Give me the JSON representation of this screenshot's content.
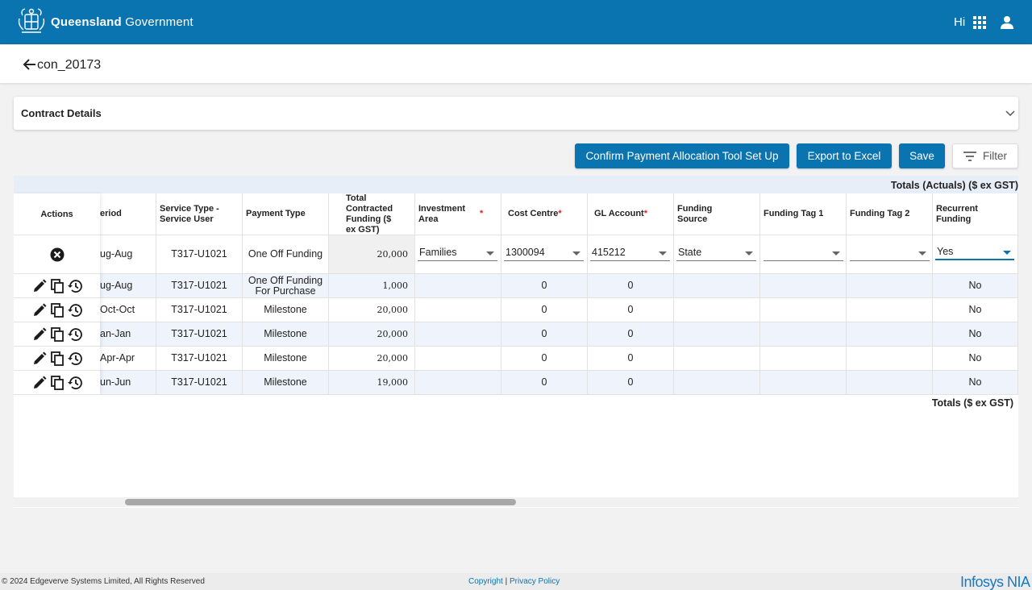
{
  "header": {
    "brand_bold": "Queensland",
    "brand_rest": "Government",
    "greeting": "Hi"
  },
  "page": {
    "title": "con_20173"
  },
  "panel": {
    "title": "Contract Details"
  },
  "toolbar": {
    "confirm_label": "Confirm Payment Allocation Tool Set Up",
    "export_label": "Export to Excel",
    "save_label": "Save",
    "filter_label": "Filter"
  },
  "grid": {
    "totals_actuals": "Totals (Actuals) ($ ex GST)",
    "totals": "Totals ($ ex GST)",
    "columns": {
      "actions": "Actions",
      "period": "eriod",
      "service_type": "Service Type - Service User",
      "payment_type": "Payment Type",
      "total_funding": "Total Contracted Funding ($ ex GST)",
      "investment_area": "Investment Area",
      "cost_centre": "Cost Centre",
      "gl_account": "GL Account",
      "funding_source": "Funding Source",
      "funding_tag1": "Funding Tag 1",
      "funding_tag2": "Funding Tag 2",
      "recurrent": "Recurrent Funding"
    },
    "required_mark": "*",
    "edit_row": {
      "period": "ug-Aug",
      "service_type": "T317-U1021",
      "payment_type": "One Off Funding",
      "total_funding": "20,000",
      "investment_area": "Families",
      "cost_centre": "1300094",
      "gl_account": "415212",
      "funding_source": "State",
      "funding_tag1": "",
      "funding_tag2": "",
      "recurrent": "Yes"
    },
    "rows": [
      {
        "period": "ug-Aug",
        "service_type": "T317-U1021",
        "payment_type": "One Off Funding For Purchase",
        "total_funding": "1,000",
        "cost_centre": "0",
        "gl_account": "0",
        "recurrent": "No"
      },
      {
        "period": "Oct-Oct",
        "service_type": "T317-U1021",
        "payment_type": "Milestone",
        "total_funding": "20,000",
        "cost_centre": "0",
        "gl_account": "0",
        "recurrent": "No"
      },
      {
        "period": "an-Jan",
        "service_type": "T317-U1021",
        "payment_type": "Milestone",
        "total_funding": "20,000",
        "cost_centre": "0",
        "gl_account": "0",
        "recurrent": "No"
      },
      {
        "period": "Apr-Apr",
        "service_type": "T317-U1021",
        "payment_type": "Milestone",
        "total_funding": "20,000",
        "cost_centre": "0",
        "gl_account": "0",
        "recurrent": "No"
      },
      {
        "period": "un-Jun",
        "service_type": "T317-U1021",
        "payment_type": "Milestone",
        "total_funding": "19,000",
        "cost_centre": "0",
        "gl_account": "0",
        "recurrent": "No"
      }
    ]
  },
  "footer": {
    "copyright": "© 2024 Edgeverve Systems Limited, All Rights Reserved",
    "copyright_link": "Copyright",
    "separator": "|",
    "privacy_link": "Privacy Policy",
    "logo": "Infosys NIA"
  },
  "colors": {
    "brand": "#0a74b0",
    "row_alt": "#eef3fc",
    "required": "#dd2222"
  }
}
